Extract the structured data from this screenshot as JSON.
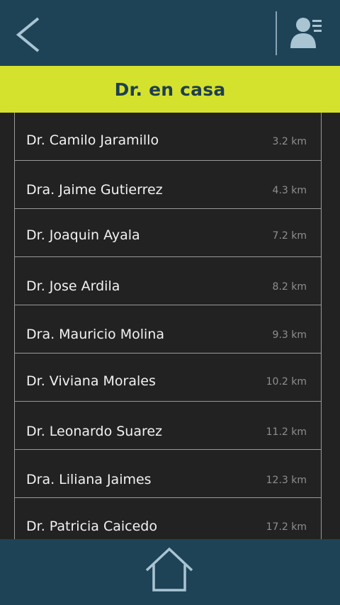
{
  "header": {
    "back_icon": "chevron-left-icon",
    "contacts_icon": "contacts-list-icon"
  },
  "title": "Dr. en casa",
  "doctors": [
    {
      "name": "Dr.  Camilo Jaramillo",
      "distance": "3.2 km"
    },
    {
      "name": "Dra. Jaime Gutierrez",
      "distance": "4.3 km"
    },
    {
      "name": "Dr. Joaquin Ayala",
      "distance": "7.2 km"
    },
    {
      "name": "Dr. Jose Ardila",
      "distance": "8.2 km"
    },
    {
      "name": "Dra. Mauricio Molina",
      "distance": "9.3 km"
    },
    {
      "name": "Dr. Viviana Morales",
      "distance": "10.2 km"
    },
    {
      "name": "Dr. Leonardo Suarez",
      "distance": "11.2 km"
    },
    {
      "name": "Dra. Liliana Jaimes",
      "distance": "12.3 km"
    },
    {
      "name": "Dr. Patricia Caicedo",
      "distance": "17.2 km"
    }
  ],
  "footer": {
    "home_icon": "home-icon"
  },
  "colors": {
    "bar_background": "#1e4357",
    "title_background": "#d5e22d",
    "list_background": "#222222",
    "icon_color": "#a9c4d2"
  }
}
